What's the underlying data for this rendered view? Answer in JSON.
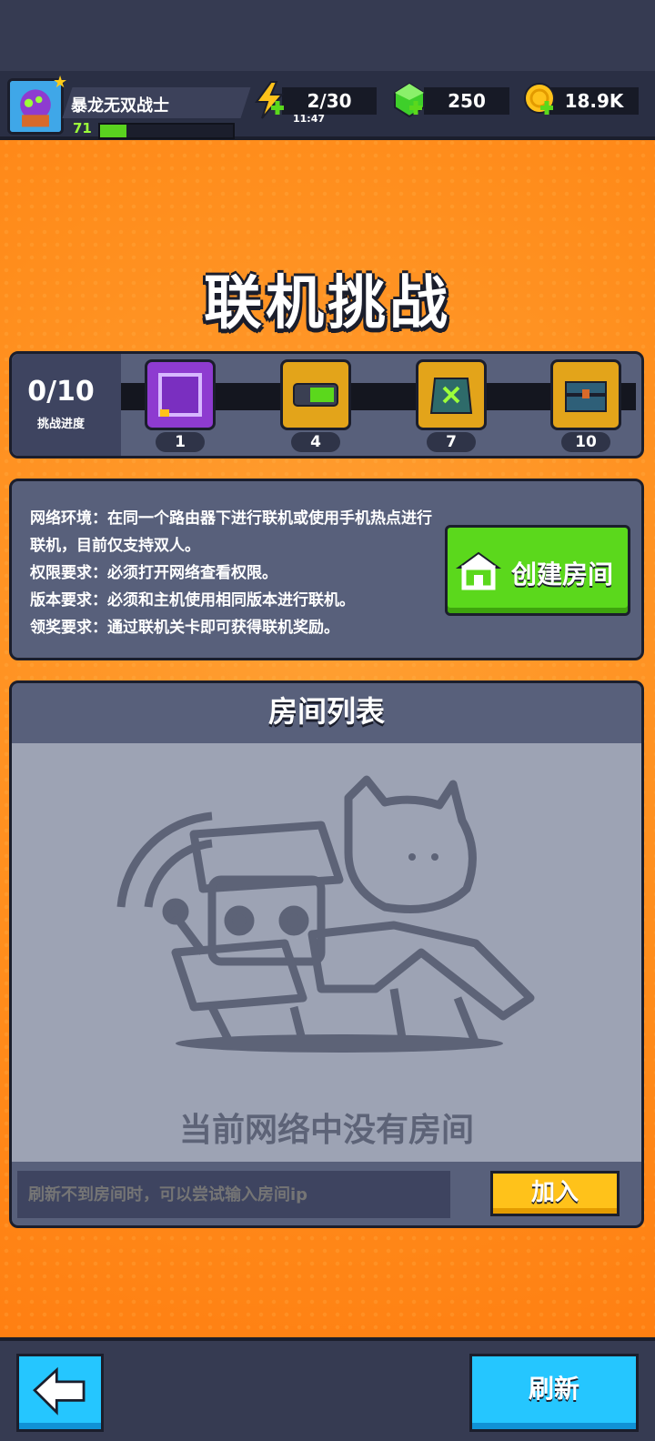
{
  "player": {
    "name": "暴龙无双战士",
    "level": "71",
    "xp_fraction": 0.2
  },
  "resources": {
    "energy": {
      "value": "2/30",
      "timer": "11:47",
      "icon": "lightning-icon"
    },
    "gems": {
      "value": "250",
      "icon": "green-gem-icon"
    },
    "coins": {
      "value": "18.9K",
      "icon": "gold-coin-icon"
    }
  },
  "page": {
    "title": "联机挑战"
  },
  "challenge": {
    "progress": "0/10",
    "progress_label": "挑战进度",
    "milestones": [
      {
        "count": "1",
        "icon": "purple-frame-icon"
      },
      {
        "count": "4",
        "icon": "goggles-icon"
      },
      {
        "count": "7",
        "icon": "armor-vest-icon"
      },
      {
        "count": "10",
        "icon": "treasure-chest-icon"
      }
    ]
  },
  "info": {
    "lines": [
      "网络环境：在同一个路由器下进行联机或使用手机热点进行联机，目前仅支持双人。",
      "权限要求：必须打开网络查看权限。",
      "版本要求：必须和主机使用相同版本进行联机。",
      "领奖要求：通过联机关卡即可获得联机奖励。"
    ],
    "create_button": "创建房间"
  },
  "room_list": {
    "title": "房间列表",
    "empty_text": "当前网络中没有房间",
    "ip_placeholder": "刷新不到房间时，可以尝试输入房间ip",
    "join_button": "加入"
  },
  "bottom": {
    "refresh_button": "刷新"
  },
  "colors": {
    "orange_bg": "#ff8f1f",
    "panel": "#58607b",
    "green_btn": "#5bd81c",
    "yellow_btn": "#ffc21a",
    "blue_btn": "#25c6ff"
  }
}
